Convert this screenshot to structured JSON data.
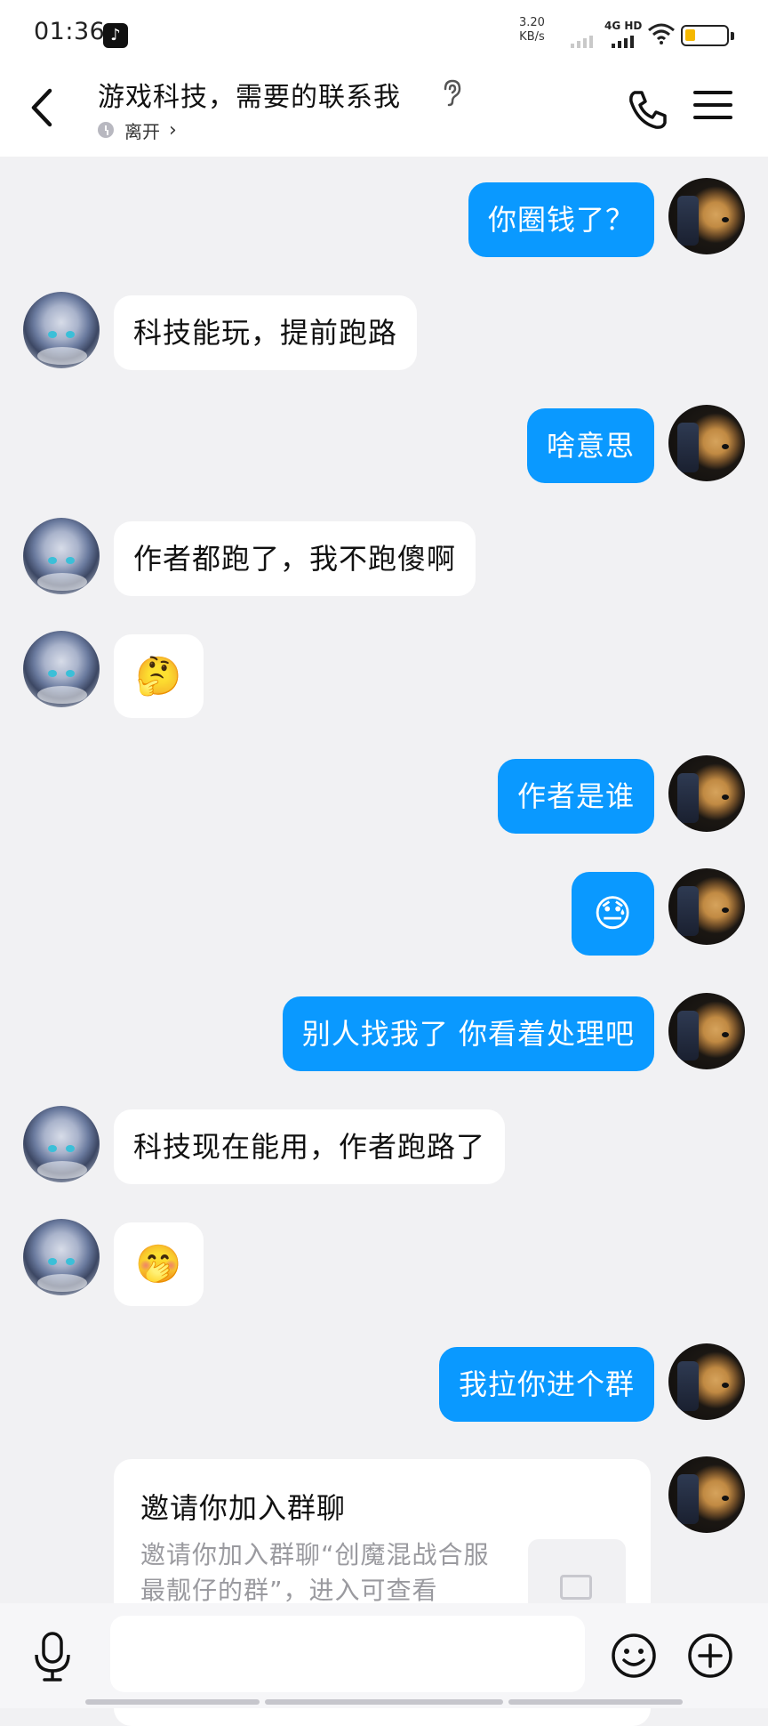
{
  "status_bar": {
    "time": "01:36",
    "speed_value": "3.20",
    "speed_unit": "KB/s",
    "network": "4G HD",
    "icons": [
      "tiktok-icon",
      "signal-icon",
      "wifi-icon",
      "battery-icon"
    ],
    "battery_level": 0.2
  },
  "header": {
    "title": "游戏科技，需要的联系我",
    "presence": "离开",
    "icons": [
      "back-icon",
      "ear-icon",
      "phone-icon",
      "menu-icon"
    ]
  },
  "messages": [
    {
      "side": "me",
      "type": "text",
      "text": "你圈钱了？"
    },
    {
      "side": "them",
      "type": "text",
      "text": "科技能玩，提前跑路"
    },
    {
      "side": "me",
      "type": "text",
      "text": "啥意思"
    },
    {
      "side": "them",
      "type": "text",
      "text": "作者都跑了，我不跑傻啊"
    },
    {
      "side": "them",
      "type": "emoji",
      "text": "🤔"
    },
    {
      "side": "me",
      "type": "text",
      "text": "作者是谁"
    },
    {
      "side": "me",
      "type": "emoji",
      "text": "😓"
    },
    {
      "side": "me",
      "type": "text",
      "text": "别人找我了 你看着处理吧"
    },
    {
      "side": "them",
      "type": "text",
      "text": "科技现在能用，作者跑路了"
    },
    {
      "side": "them",
      "type": "emoji",
      "text": "🤭"
    },
    {
      "side": "me",
      "type": "text",
      "text": "我拉你进个群"
    }
  ],
  "invite": {
    "title": "邀请你加入群聊",
    "description": "邀请你加入群聊“创魔混战合服最靓仔的群”，进入可查看"
  },
  "input_bar": {
    "placeholder": "",
    "icons": [
      "mic-icon",
      "emoji-icon",
      "plus-icon"
    ]
  },
  "colors": {
    "my_bubble": "#0a99ff",
    "their_bubble": "#ffffff",
    "background": "#f1f1f3"
  }
}
